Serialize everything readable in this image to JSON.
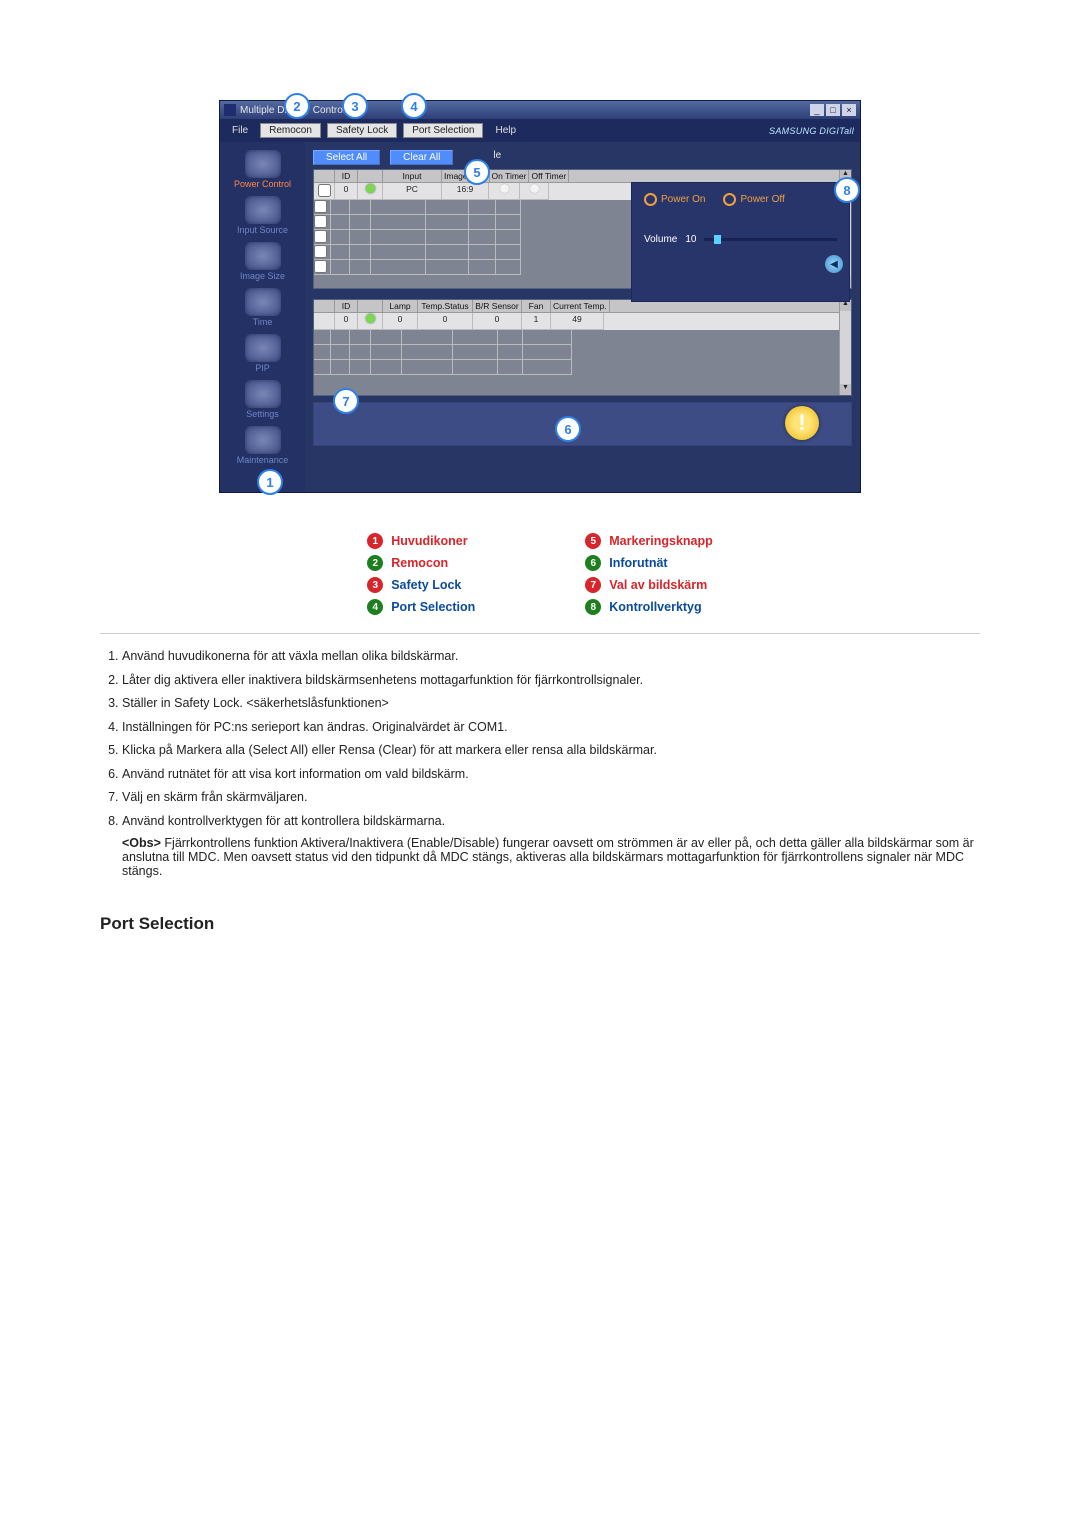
{
  "window": {
    "title": "Multiple Display Control",
    "brand": "SAMSUNG DIGITall"
  },
  "menu": {
    "file": "File",
    "remocon": "Remocon",
    "safety_lock": "Safety Lock",
    "port_selection": "Port Selection",
    "help": "Help"
  },
  "sidebar": {
    "items": [
      {
        "label": "Power Control"
      },
      {
        "label": "Input Source"
      },
      {
        "label": "Image Size"
      },
      {
        "label": "Time"
      },
      {
        "label": "PIP"
      },
      {
        "label": "Settings"
      },
      {
        "label": "Maintenance"
      }
    ]
  },
  "toolbar": {
    "select_all": "Select All",
    "clear_all": "Clear All",
    "mode_suffix": "le"
  },
  "grid": {
    "headers": [
      "",
      "ID",
      "",
      "Input",
      "Image Size",
      "On Timer",
      "Off Timer"
    ],
    "row": {
      "checked": false,
      "id": "0",
      "power": "on",
      "input": "PC",
      "image_size": "16:9",
      "on_timer": "off",
      "off_timer": "off"
    }
  },
  "info": {
    "headers": [
      "",
      "ID",
      "",
      "Lamp",
      "Temp.Status",
      "B/R Sensor",
      "Fan",
      "Current Temp."
    ],
    "row": {
      "id": "0",
      "power": "on",
      "lamp": "0",
      "temp_status": "0",
      "br_sensor": "0",
      "fan": "1",
      "current_temp": "49"
    }
  },
  "ctrl": {
    "power_on": "Power On",
    "power_off": "Power Off",
    "volume_label": "Volume",
    "volume_value": "10"
  },
  "callouts": [
    "1",
    "2",
    "3",
    "4",
    "5",
    "6",
    "7",
    "8"
  ],
  "legend": {
    "left": [
      {
        "num": "1",
        "label": "Huvudikoner"
      },
      {
        "num": "2",
        "label": "Remocon"
      },
      {
        "num": "3",
        "label": "Safety Lock"
      },
      {
        "num": "4",
        "label": "Port Selection"
      }
    ],
    "right": [
      {
        "num": "5",
        "label": "Markeringsknapp"
      },
      {
        "num": "6",
        "label": "Inforutnät"
      },
      {
        "num": "7",
        "label": "Val av bildskärm"
      },
      {
        "num": "8",
        "label": "Kontrollverktyg"
      }
    ]
  },
  "notes": [
    "Använd huvudikonerna för att växla mellan olika bildskärmar.",
    "Låter dig aktivera eller inaktivera bildskärmsenhetens mottagarfunktion för fjärrkontrollsignaler.",
    "Ställer in Safety Lock. <säkerhetslåsfunktionen>",
    "Inställningen för PC:ns serieport kan ändras. Originalvärdet är COM1.",
    "Klicka på Markera alla (Select All) eller Rensa (Clear) för att markera eller rensa alla bildskärmar.",
    "Använd rutnätet för att visa kort information om vald bildskärm.",
    "Välj en skärm från skärmväljaren.",
    "Använd kontrollverktygen för att kontrollera bildskärmarna."
  ],
  "obs": {
    "label": "<Obs>",
    "text": "Fjärrkontrollens funktion Aktivera/Inaktivera (Enable/Disable) fungerar oavsett om strömmen är av eller på, och detta gäller alla bildskärmar som är anslutna till MDC. Men oavsett status vid den tidpunkt då MDC stängs, aktiveras alla bildskärmars mottagarfunktion för fjärrkontrollens signaler när MDC stängs."
  },
  "section_heading": "Port Selection"
}
